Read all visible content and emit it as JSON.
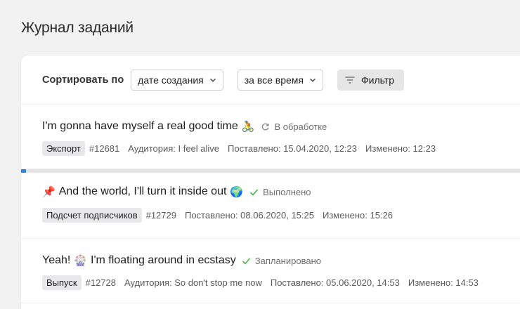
{
  "header": {
    "title": "Журнал заданий"
  },
  "toolbar": {
    "sort_label": "Сортировать по",
    "sort_value": "дате создания",
    "period_value": "за все время",
    "filter_label": "Фильтр"
  },
  "jobs": [
    {
      "title": "I'm gonna have myself a real good time",
      "emoji_after": "🚴",
      "status": "В обработке",
      "status_icon": "refresh-icon",
      "tag": "Экспорт",
      "id": "#12681",
      "audience": "Аудитория: I feel alive",
      "submitted": "Поставлено: 15.04.2020, 12:23",
      "changed": "Изменено: 12:23",
      "progress": 0.01
    },
    {
      "emoji_before": "📌",
      "title": "And the world, I'll turn it inside out",
      "emoji_after": "🌍",
      "status": "Выполнено",
      "status_icon": "check-icon",
      "tag": "Подсчет подписчиков",
      "id": "#12729",
      "submitted": "Поставлено: 08.06.2020, 15:25",
      "changed": "Изменено: 15:26"
    },
    {
      "title_prefix": "Yeah!",
      "emoji_mid": "🎡",
      "title": "I'm floating around in ecstasy",
      "status": "Запланировано",
      "status_icon": "check-icon",
      "tag": "Выпуск",
      "id": "#12728",
      "audience": "Аудитория: So don't stop me now",
      "submitted": "Поставлено: 05.06.2020, 14:53",
      "changed": "Изменено: 14:53"
    }
  ],
  "colors": {
    "progress": "#2f86d6",
    "check": "#4caf50"
  }
}
